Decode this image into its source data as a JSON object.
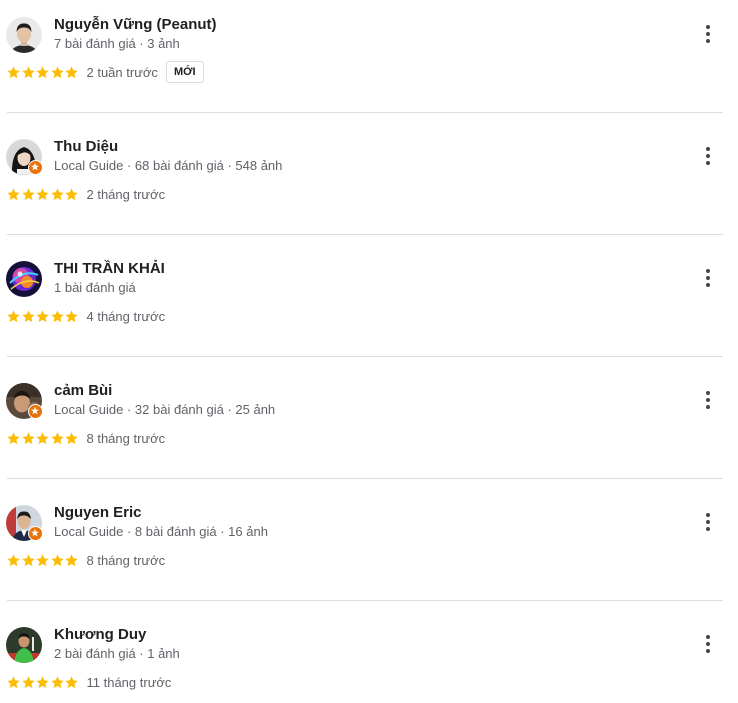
{
  "reviews": [
    {
      "name": "Nguyễn Vững (Peanut)",
      "meta": "7 bài đánh giá · 3 ảnh",
      "rating": 5,
      "time": "2 tuần trước",
      "badge": "MỚI",
      "local_guide": false,
      "avatar": "avatar-man-dark-hair"
    },
    {
      "name": "Thu Diệu",
      "meta": "Local Guide · 68 bài đánh giá · 548 ảnh",
      "rating": 5,
      "time": "2 tháng trước",
      "badge": "",
      "local_guide": true,
      "avatar": "avatar-woman-long-hair"
    },
    {
      "name": "THI TRẦN KHẢI",
      "meta": "1 bài đánh giá",
      "rating": 5,
      "time": "4 tháng trước",
      "badge": "",
      "local_guide": false,
      "avatar": "avatar-colorful-orb"
    },
    {
      "name": "cảm Bùi",
      "meta": "Local Guide · 32 bài đánh giá · 25 ảnh",
      "rating": 5,
      "time": "8 tháng trước",
      "badge": "",
      "local_guide": true,
      "avatar": "avatar-man-photo"
    },
    {
      "name": "Nguyen Eric",
      "meta": "Local Guide · 8 bài đánh giá · 16 ảnh",
      "rating": 5,
      "time": "8 tháng trước",
      "badge": "",
      "local_guide": true,
      "avatar": "avatar-man-suit"
    },
    {
      "name": "Khương Duy",
      "meta": "2 bài đánh giá · 1 ảnh",
      "rating": 5,
      "time": "11 tháng trước",
      "badge": "",
      "local_guide": false,
      "avatar": "avatar-player-green"
    }
  ],
  "colors": {
    "star": "#fbbc04",
    "local_guide_badge": "#e8710a",
    "divider": "#dadce0",
    "secondary_text": "#5f6368"
  },
  "icons": {
    "more": "more-vert-icon",
    "star": "star-icon",
    "local_guide": "local-guide-badge-icon"
  }
}
